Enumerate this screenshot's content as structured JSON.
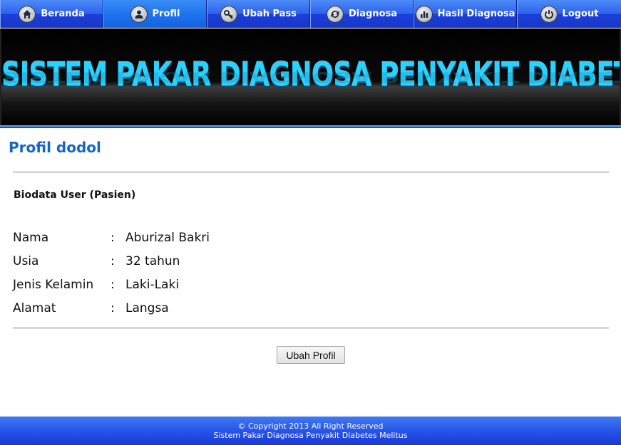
{
  "nav": {
    "items": [
      {
        "label": "Beranda",
        "icon": "home-icon"
      },
      {
        "label": "Profil",
        "icon": "user-icon"
      },
      {
        "label": "Ubah Pass",
        "icon": "key-icon"
      },
      {
        "label": "Diagnosa",
        "icon": "refresh-icon"
      },
      {
        "label": "Hasil Diagnosa",
        "icon": "bar-chart-icon"
      },
      {
        "label": "Logout",
        "icon": "power-icon"
      }
    ],
    "active_index": 1
  },
  "banner": {
    "title": "SISTEM PAKAR DIAGNOSA PENYAKIT DIABETES MELITUS"
  },
  "page": {
    "title": "Profil dodol",
    "section_title": "Biodata User (Pasien)",
    "biodata": [
      {
        "label": "Nama",
        "value": "Aburizal Bakri"
      },
      {
        "label": "Usia",
        "value": "32 tahun"
      },
      {
        "label": "Jenis Kelamin",
        "value": "Laki-Laki"
      },
      {
        "label": "Alamat",
        "value": "Langsa"
      }
    ],
    "separator": ":",
    "edit_button_label": "Ubah Profil"
  },
  "footer": {
    "line1": "© Copyright 2013 All Right Reserved",
    "line2": "Sistem Pakar Diagnosa Penyakit Diabetes Melitus"
  },
  "colors": {
    "nav_blue": "#2f63ee",
    "title_blue": "#1566c9",
    "banner_text": "#29d2ff"
  }
}
